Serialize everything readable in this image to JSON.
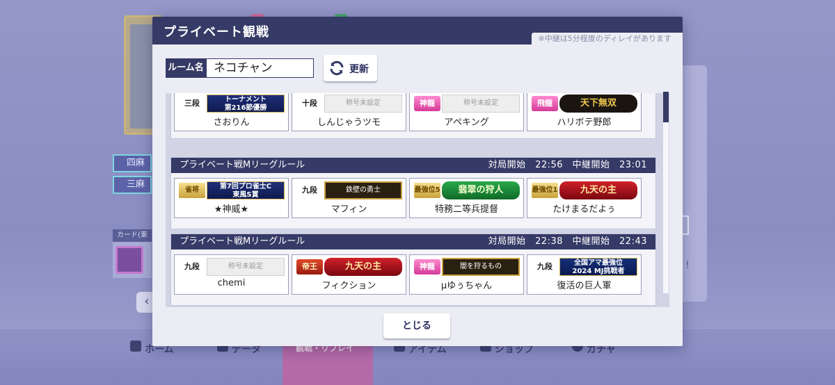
{
  "background": {
    "modes": [
      "四麻",
      "三麻"
    ],
    "card_label": "カード(東",
    "nav": [
      "ホーム",
      "データ",
      "観戦・リプレイ",
      "アイテム",
      "ショップ",
      "ガチャ"
    ]
  },
  "modal": {
    "title": "プライベート観戦",
    "note": "※中継は5分程度のディレイがあります",
    "room_label": "ルーム名",
    "room_value": "ネコチャン",
    "refresh_label": "更新",
    "close_label": "とじる",
    "matches": [
      {
        "rule": "",
        "time": "",
        "players": [
          {
            "rank": "三段",
            "rank_style": "plain",
            "title": "トーナメント\n第216節優勝",
            "title_style": "navy",
            "name": "さおりん"
          },
          {
            "rank": "十段",
            "rank_style": "plain",
            "title": "称号未設定",
            "title_style": "unset",
            "name": "しんじゃうツモ"
          },
          {
            "rank": "神龍",
            "rank_style": "pink",
            "title": "称号未設定",
            "title_style": "unset",
            "name": "アペキング"
          },
          {
            "rank": "飛龍",
            "rank_style": "pink",
            "title": "天下無双",
            "title_style": "black",
            "name": "ハリボテ野郎"
          }
        ]
      },
      {
        "rule": "プライベート戦Mリーグルール",
        "time": "対局開始　22:56　中継開始　23:01",
        "players": [
          {
            "rank": "雀将",
            "rank_style": "gold",
            "title": "第7回プロ雀士C\n東風S賞",
            "title_style": "navy",
            "name": "★神威★"
          },
          {
            "rank": "九段",
            "rank_style": "plain",
            "title": "鉄壁の勇士",
            "title_style": "plate",
            "name": "マフィン"
          },
          {
            "rank": "最強位5",
            "rank_style": "gold",
            "title": "翡翠の狩人",
            "title_style": "green",
            "name": "特務二等兵提督"
          },
          {
            "rank": "最強位1",
            "rank_style": "gold",
            "title": "九天の主",
            "title_style": "crimson",
            "name": "たけまるだよぅ"
          }
        ]
      },
      {
        "rule": "プライベート戦Mリーグルール",
        "time": "対局開始　22:38　中継開始　22:43",
        "players": [
          {
            "rank": "九段",
            "rank_style": "plain",
            "title": "称号未設定",
            "title_style": "unset",
            "name": "chemi"
          },
          {
            "rank": "帝王",
            "rank_style": "red",
            "title": "九天の主",
            "title_style": "crimson",
            "name": "フィクション"
          },
          {
            "rank": "神龍",
            "rank_style": "pink",
            "title": "闇を狩るもの",
            "title_style": "plate",
            "name": "μゆぅちゃん"
          },
          {
            "rank": "九段",
            "rank_style": "plain",
            "title": "全国アマ最強位\n2024 MJ挑戦者",
            "title_style": "navy2",
            "name": "復活の巨人軍"
          }
        ]
      }
    ]
  },
  "colors": {
    "header": "#353a66",
    "modal_bg": "#ececf4",
    "list_bg": "#d2d3e4"
  }
}
